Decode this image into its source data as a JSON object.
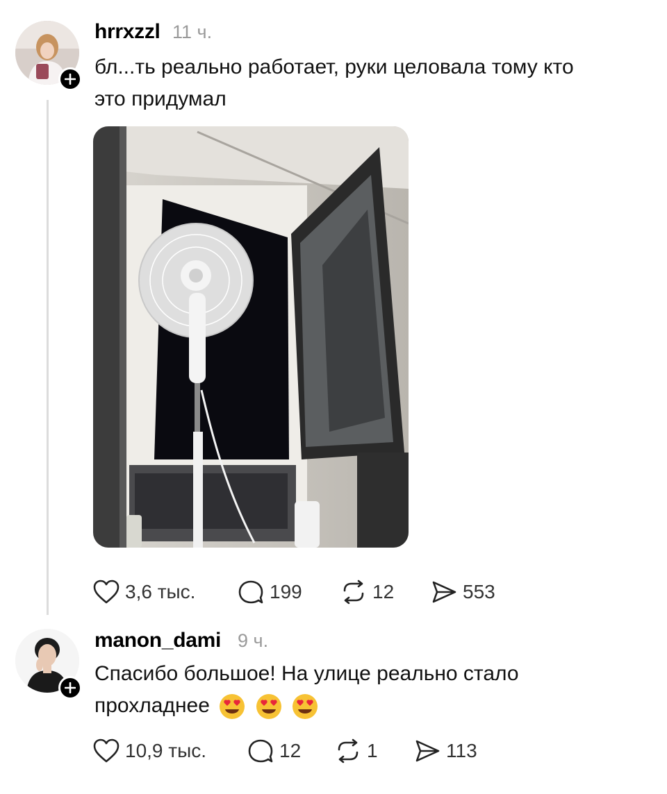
{
  "posts": [
    {
      "username": "hrrxzzl",
      "time": "11 ч.",
      "text_line1": "бл...ть реально работает, руки целовала тому кто",
      "text_line2": "это придумал",
      "likes": "3,6 тыс.",
      "replies": "199",
      "reposts": "12",
      "shares": "553"
    },
    {
      "username": "manon_dami",
      "time": "9 ч.",
      "text_line1": "Спасибо большое! На улице реально стало",
      "text_line2": "прохладнее",
      "likes": "10,9 тыс.",
      "replies": "12",
      "reposts": "1",
      "shares": "113"
    }
  ],
  "icons": {
    "like": "heart-icon",
    "reply": "comment-bubble-icon",
    "repost": "repost-icon",
    "share": "send-icon",
    "follow": "plus-icon",
    "emoji": "heart-eyes-emoji-icon"
  },
  "colors": {
    "text": "#111111",
    "muted": "#9a9a9a",
    "thread_line": "#dcdcdc",
    "follow_badge": "#000000"
  }
}
